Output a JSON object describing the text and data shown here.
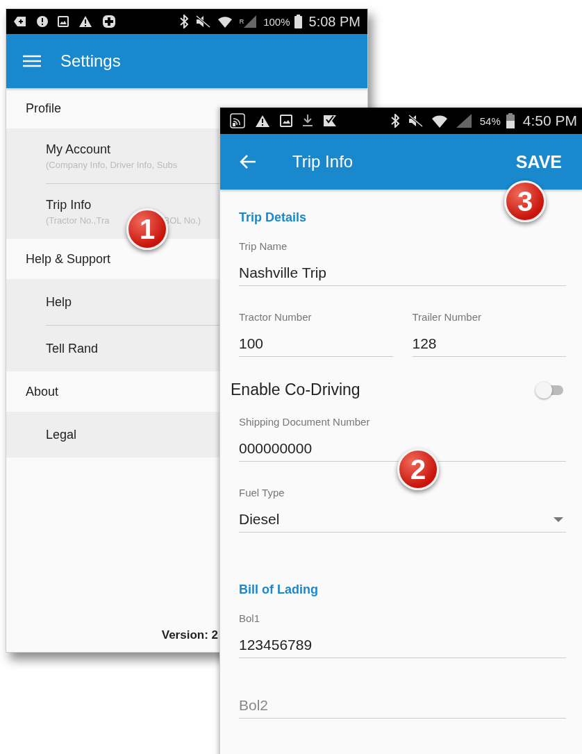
{
  "settings_screen": {
    "status_bar": {
      "roaming": "R",
      "battery": "100%",
      "time": "5:08 PM"
    },
    "app_bar": {
      "title": "Settings"
    },
    "sections": [
      {
        "title": "Profile",
        "items": [
          {
            "title": "My Account",
            "subtitle_parts": [
              "(Company Info, Driver Info, Subs"
            ]
          },
          {
            "title": "Trip Info",
            "subtitle_parts": [
              "(Tractor No.,Tra",
              "BOL No.)"
            ]
          }
        ]
      },
      {
        "title": "Help & Support",
        "items": [
          {
            "title": "Help"
          },
          {
            "title": "Tell Rand"
          }
        ]
      },
      {
        "title": "About",
        "items": [
          {
            "title": "Legal"
          }
        ]
      }
    ],
    "version": "Version: 2"
  },
  "trip_info_screen": {
    "status_bar": {
      "battery": "54%",
      "time": "4:50 PM"
    },
    "app_bar": {
      "title": "Trip Info",
      "action": "SAVE"
    },
    "rows": [
      {
        "kind": "heading",
        "text": "Trip Details"
      },
      {
        "kind": "field",
        "label": "Trip Name",
        "value": "Nashville Trip"
      },
      {
        "kind": "pair",
        "fields": [
          {
            "label": "Tractor Number",
            "value": "100"
          },
          {
            "label": "Trailer Number",
            "value": "128"
          }
        ]
      },
      {
        "kind": "toggle",
        "label": "Enable Co-Driving",
        "on": false
      },
      {
        "kind": "field",
        "label": "Shipping Document Number",
        "value": "000000000"
      },
      {
        "kind": "dropdown",
        "label": "Fuel Type",
        "value": "Diesel"
      },
      {
        "kind": "heading",
        "text": "Bill of Lading"
      },
      {
        "kind": "field",
        "label": "Bol1",
        "value": "123456789"
      },
      {
        "kind": "field",
        "placeholder": "Bol2"
      }
    ]
  },
  "annotations": [
    {
      "label": "1"
    },
    {
      "label": "2"
    },
    {
      "label": "3"
    }
  ]
}
